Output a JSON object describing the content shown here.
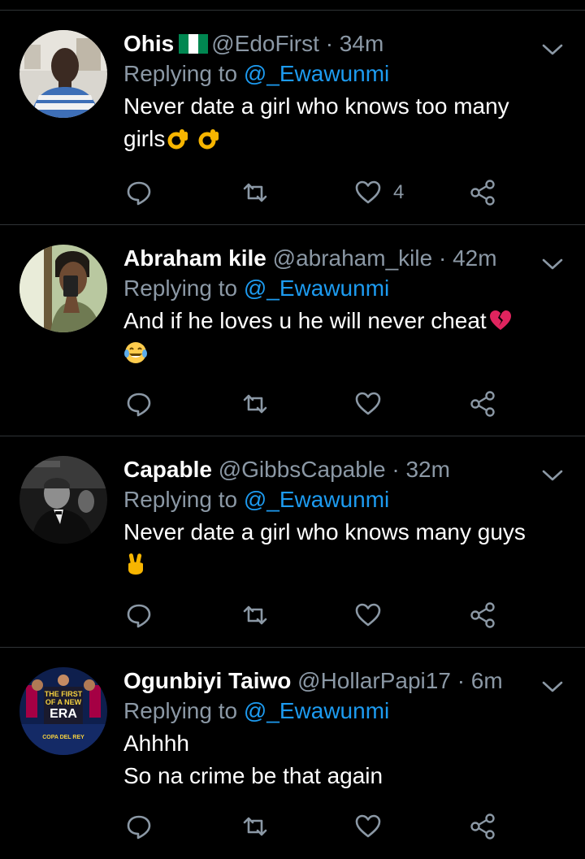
{
  "tweets": [
    {
      "display_name": "Ohis",
      "has_flag": true,
      "handle": "@EdoFirst",
      "dot": "·",
      "time": "34m",
      "replying_prefix": "Replying to",
      "replying_to": "@_Ewawunmi",
      "text_lines": [
        "Never date a girl who knows too many",
        "girls"
      ],
      "like_count": "4"
    },
    {
      "display_name": "Abraham kile",
      "handle": "@abraham_kile",
      "dot": "·",
      "time": "42m",
      "replying_prefix": "Replying to",
      "replying_to": "@_Ewawunmi",
      "text_lines": [
        "And if he loves u he will never cheat"
      ],
      "like_count": ""
    },
    {
      "display_name": "Capable",
      "handle": "@GibbsCapable",
      "dot": "·",
      "time": "32m",
      "replying_prefix": "Replying to",
      "replying_to": "@_Ewawunmi",
      "text_lines": [
        "Never date a girl who knows many guys"
      ],
      "like_count": ""
    },
    {
      "display_name": "Ogunbiyi Taiwo",
      "handle": "@HollarPapi17",
      "dot": "·",
      "time": "6m",
      "replying_prefix": "Replying to",
      "replying_to": "@_Ewawunmi",
      "text_lines": [
        "Ahhhh",
        "So na crime be that again"
      ],
      "avatar_text": [
        "THE FIRST",
        "OF A NEW",
        "ERA",
        "COPA DEL REY"
      ],
      "like_count": ""
    }
  ],
  "colors": {
    "background": "#000000",
    "secondary_text": "#8b98a5",
    "mention": "#1d9bf0",
    "divider": "#2f3336"
  },
  "icons": {
    "reply": "speech-bubble-icon",
    "retweet": "retweet-arrows-icon",
    "like": "heart-outline-icon",
    "share": "share-nodes-icon",
    "more": "chevron-down-icon",
    "emoji_ok": "ok-hand-emoji",
    "emoji_broken_heart": "broken-heart-emoji",
    "emoji_laugh": "tears-of-joy-emoji",
    "emoji_victory": "victory-hand-emoji"
  }
}
